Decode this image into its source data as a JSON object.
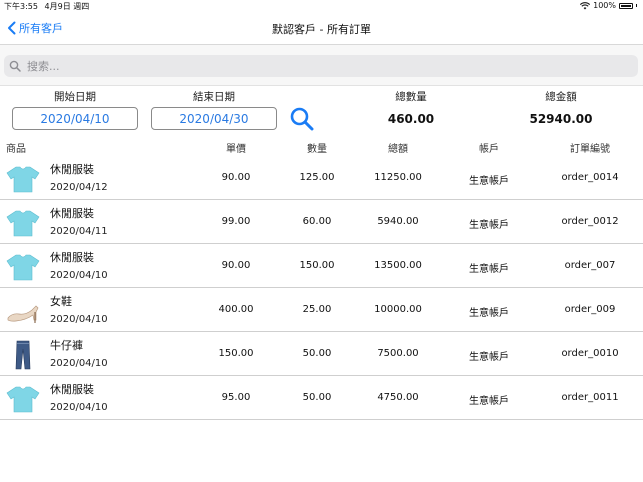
{
  "status_bar": {
    "time": "下午3:55",
    "date": "4月9日 週四",
    "battery": "100%"
  },
  "nav": {
    "back_label": "所有客戶",
    "title": "默認客戶 - 所有訂單"
  },
  "search": {
    "placeholder": "搜索..."
  },
  "filters": {
    "start_label": "開始日期",
    "start_value": "2020/04/10",
    "end_label": "結束日期",
    "end_value": "2020/04/30"
  },
  "summary": {
    "qty_label": "總數量",
    "qty_value": "460.00",
    "amount_label": "總金額",
    "amount_value": "52940.00"
  },
  "columns": [
    "商品",
    "單價",
    "數量",
    "總額",
    "帳戶",
    "訂單編號"
  ],
  "orders": [
    {
      "product": "休閒服裝",
      "date": "2020/04/12",
      "price": "90.00",
      "qty": "125.00",
      "total": "11250.00",
      "account": "生意帳戶",
      "order_no": "order_0014",
      "icon": "tshirt-icon"
    },
    {
      "product": "休閒服裝",
      "date": "2020/04/11",
      "price": "99.00",
      "qty": "60.00",
      "total": "5940.00",
      "account": "生意帳戶",
      "order_no": "order_0012",
      "icon": "tshirt-icon"
    },
    {
      "product": "休閒服裝",
      "date": "2020/04/10",
      "price": "90.00",
      "qty": "150.00",
      "total": "13500.00",
      "account": "生意帳戶",
      "order_no": "order_007",
      "icon": "tshirt-icon"
    },
    {
      "product": "女鞋",
      "date": "2020/04/10",
      "price": "400.00",
      "qty": "25.00",
      "total": "10000.00",
      "account": "生意帳戶",
      "order_no": "order_009",
      "icon": "high-heel-shoe-icon"
    },
    {
      "product": "牛仔褲",
      "date": "2020/04/10",
      "price": "150.00",
      "qty": "50.00",
      "total": "7500.00",
      "account": "生意帳戶",
      "order_no": "order_0010",
      "icon": "jeans-icon"
    },
    {
      "product": "休閒服裝",
      "date": "2020/04/10",
      "price": "95.00",
      "qty": "50.00",
      "total": "4750.00",
      "account": "生意帳戶",
      "order_no": "order_0011",
      "icon": "tshirt-icon"
    }
  ],
  "colors": {
    "accent": "#1a7cf5",
    "date_text": "#2a7ae2",
    "tshirt": "#7fd6e6"
  }
}
